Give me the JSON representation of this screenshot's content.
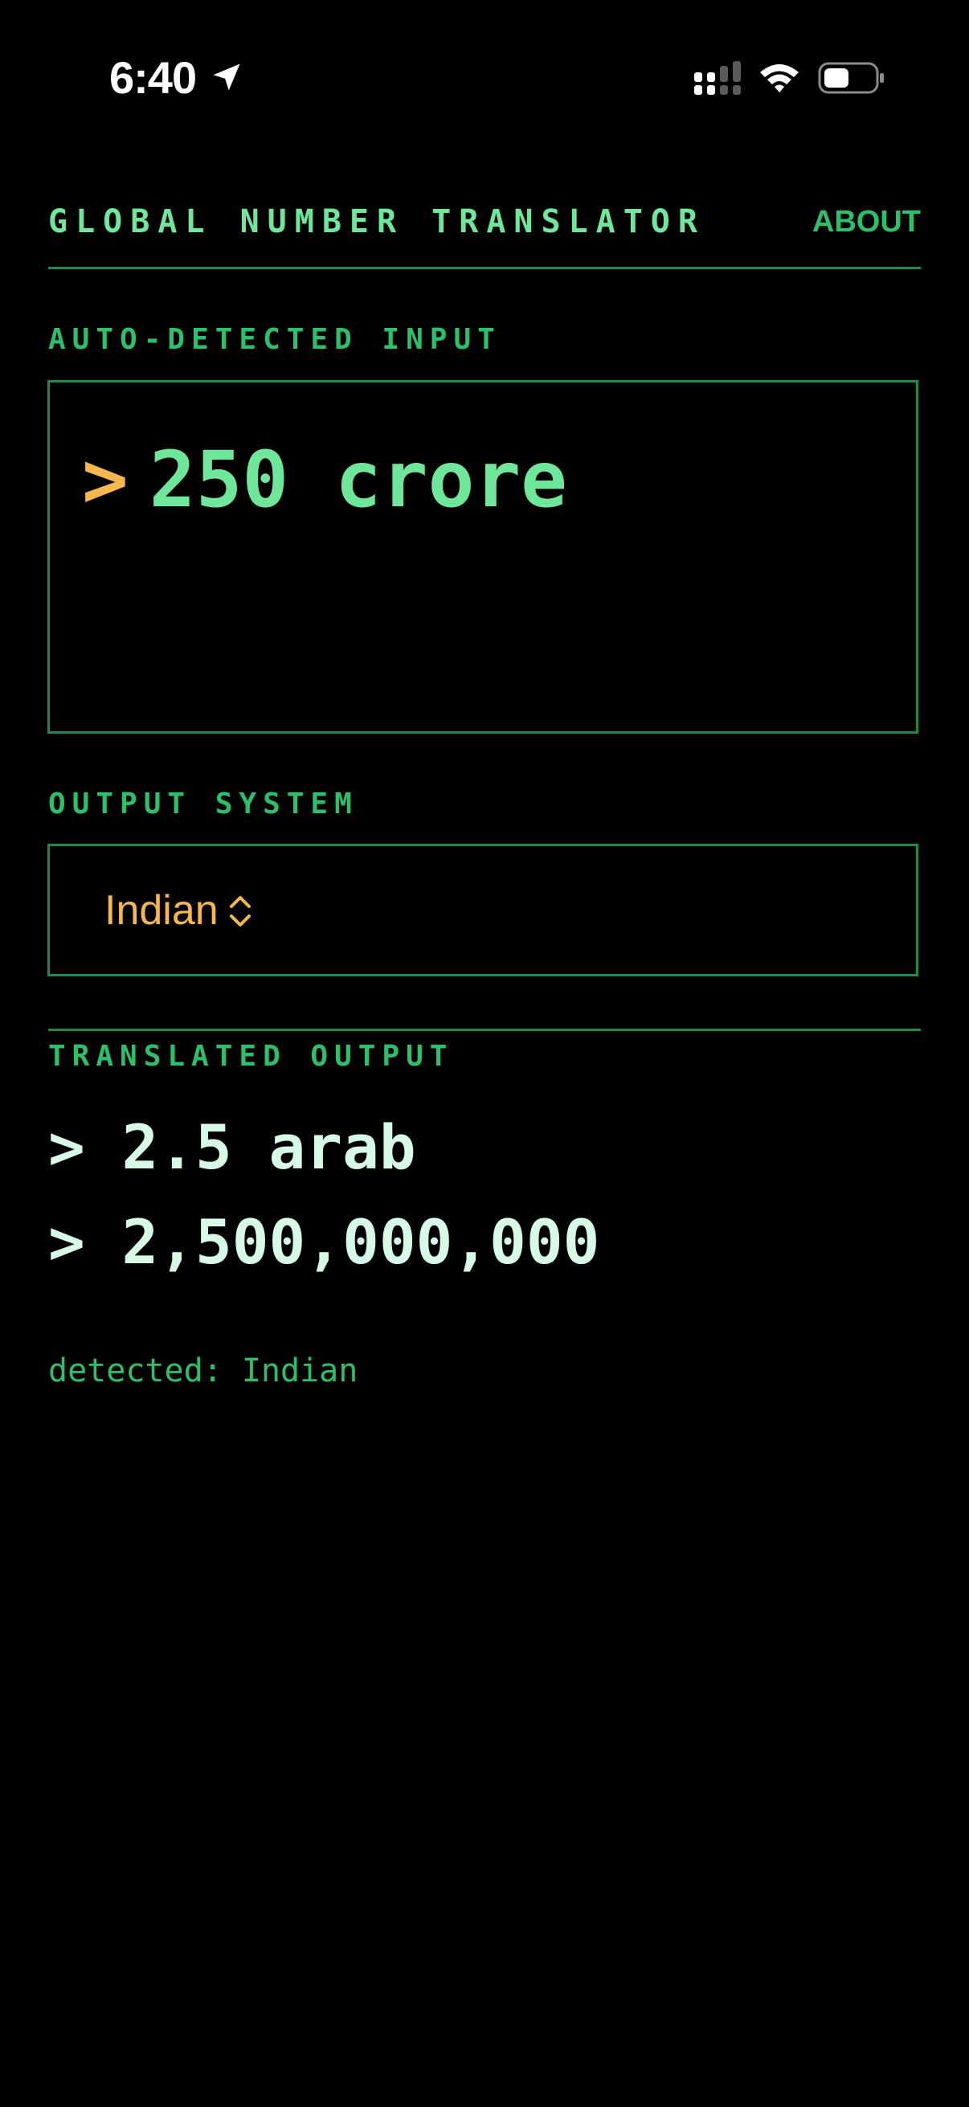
{
  "status_bar": {
    "time": "6:40",
    "icons": [
      "location-arrow-icon",
      "cellular-signal-icon",
      "wifi-icon",
      "battery-icon"
    ]
  },
  "header": {
    "title": "GLOBAL NUMBER TRANSLATOR",
    "about_label": "ABOUT"
  },
  "input_section": {
    "label": "AUTO-DETECTED INPUT",
    "prompt": ">",
    "value": "250 crore"
  },
  "output_system": {
    "label": "OUTPUT SYSTEM",
    "selected": "Indian"
  },
  "translated_output": {
    "label": "TRANSLATED OUTPUT",
    "lines": [
      {
        "prompt": ">",
        "text": "2.5 arab"
      },
      {
        "prompt": ">",
        "text": "2,500,000,000"
      }
    ]
  },
  "detected_text": "detected: Indian",
  "colors": {
    "background": "#000000",
    "primary_green": "#6ee79b",
    "muted_green": "#2dc06a",
    "border_green": "#1f8a4a",
    "accent_amber": "#f6b74f",
    "output_text": "#d7fae6"
  }
}
